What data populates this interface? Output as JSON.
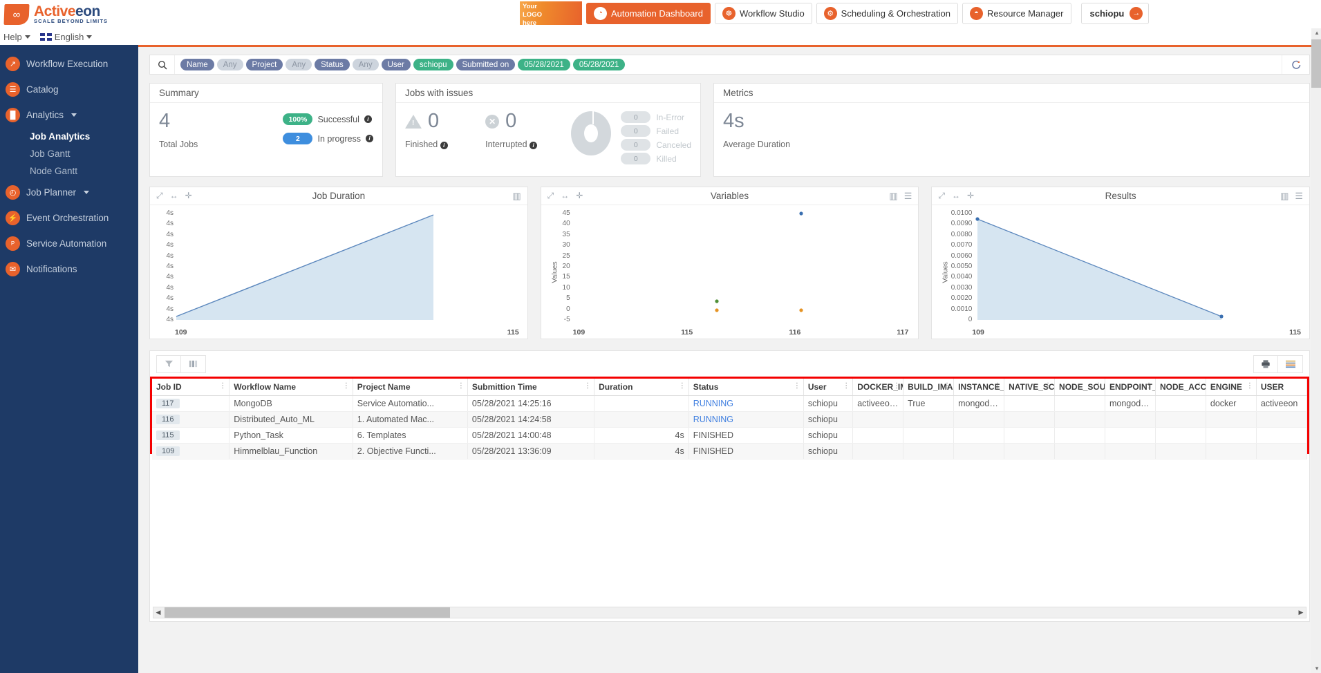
{
  "brand": {
    "name_a": "Active",
    "name_b": "eon",
    "tagline": "SCALE BEYOND LIMITS",
    "logo_glyph": "∞"
  },
  "topnav": {
    "your_logo": {
      "l1": "Your",
      "l2": "LOGO",
      "l3": "here"
    },
    "items": [
      {
        "label": "Automation Dashboard",
        "icon": "speedometer-icon",
        "glyph": "◔",
        "active": true
      },
      {
        "label": "Workflow Studio",
        "icon": "studio-icon",
        "glyph": "☸",
        "active": false
      },
      {
        "label": "Scheduling & Orchestration",
        "icon": "scheduling-icon",
        "glyph": "⚙",
        "active": false
      },
      {
        "label": "Resource Manager",
        "icon": "resource-icon",
        "glyph": "◓",
        "active": false
      }
    ],
    "user": {
      "label": "schiopu",
      "icon": "logout-icon",
      "glyph": "→"
    }
  },
  "helprow": {
    "help": "Help",
    "language": "English"
  },
  "sidebar": {
    "items": [
      {
        "label": "Workflow Execution",
        "icon": "workflow-execution-icon",
        "glyph": "↗",
        "caret": false
      },
      {
        "label": "Catalog",
        "icon": "catalog-icon",
        "glyph": "☰",
        "caret": false
      },
      {
        "label": "Analytics",
        "icon": "analytics-icon",
        "glyph": "█",
        "caret": true
      },
      {
        "label": "Job Planner",
        "icon": "job-planner-icon",
        "glyph": "◴",
        "caret": true
      },
      {
        "label": "Event Orchestration",
        "icon": "event-orchestration-icon",
        "glyph": "⚡",
        "caret": false
      },
      {
        "label": "Service Automation",
        "icon": "service-automation-icon",
        "glyph": "P",
        "caret": false
      },
      {
        "label": "Notifications",
        "icon": "notifications-icon",
        "glyph": "✉",
        "caret": false
      }
    ],
    "analytics_children": [
      {
        "label": "Job Analytics",
        "active": true
      },
      {
        "label": "Job Gantt",
        "active": false
      },
      {
        "label": "Node Gantt",
        "active": false
      }
    ]
  },
  "filterbar": {
    "search_icon": "search-icon",
    "refresh_icon": "refresh-icon",
    "chips": [
      {
        "text": "Name",
        "kind": "key"
      },
      {
        "text": "Any",
        "kind": "any"
      },
      {
        "text": "Project",
        "kind": "key"
      },
      {
        "text": "Any",
        "kind": "any"
      },
      {
        "text": "Status",
        "kind": "key"
      },
      {
        "text": "Any",
        "kind": "any"
      },
      {
        "text": "User",
        "kind": "key"
      },
      {
        "text": "schiopu",
        "kind": "val"
      },
      {
        "text": "Submitted on",
        "kind": "key"
      },
      {
        "text": "05/28/2021",
        "kind": "val"
      },
      {
        "text": "05/28/2021",
        "kind": "val"
      }
    ]
  },
  "summary": {
    "title": "Summary",
    "total_value": "4",
    "total_label": "Total Jobs",
    "rows": [
      {
        "pill": "100%",
        "label": "Successful",
        "color": "green"
      },
      {
        "pill": "2",
        "label": "In progress",
        "color": "blue"
      }
    ]
  },
  "issues": {
    "title": "Jobs with issues",
    "finished": {
      "value": "0",
      "label": "Finished"
    },
    "interrupted": {
      "value": "0",
      "label": "Interrupted"
    },
    "legend": [
      {
        "count": "0",
        "label": "In-Error"
      },
      {
        "count": "0",
        "label": "Failed"
      },
      {
        "count": "0",
        "label": "Canceled"
      },
      {
        "count": "0",
        "label": "Killed"
      }
    ]
  },
  "metrics": {
    "title": "Metrics",
    "value": "4s",
    "label": "Average Duration"
  },
  "chart_data": [
    {
      "type": "area",
      "title": "Job Duration",
      "xlabel": "",
      "ylabel": "",
      "x": [
        109,
        115
      ],
      "categories": [
        "109",
        "115"
      ],
      "values": [
        0.08,
        0.93
      ],
      "ytick_labels": [
        "4s",
        "4s",
        "4s",
        "4s",
        "4s",
        "4s",
        "4s",
        "4s",
        "4s",
        "4s",
        "4s"
      ],
      "xtick_labels": [
        "109",
        "115"
      ],
      "grid": false,
      "legend": "none",
      "tools": [
        "expand-icon",
        "resize-horizontal-icon",
        "move-icon"
      ],
      "right_tools": [
        "bar-chart-icon"
      ]
    },
    {
      "type": "scatter",
      "title": "Variables",
      "xlabel": "",
      "ylabel": "Values",
      "categories": [
        "109",
        "115",
        "116",
        "117"
      ],
      "ytick_labels": [
        "45",
        "40",
        "35",
        "30",
        "25",
        "20",
        "15",
        "10",
        "5",
        "0",
        "-5"
      ],
      "ylim": [
        -5,
        45
      ],
      "series": [
        {
          "name": "blue",
          "color": "#3a6fb0",
          "points": [
            {
              "x": "117",
              "y": 45
            }
          ]
        },
        {
          "name": "green",
          "color": "#4f8f37",
          "points": [
            {
              "x": "116",
              "y": 2
            }
          ]
        },
        {
          "name": "orange",
          "color": "#e59324",
          "points": [
            {
              "x": "116",
              "y": -1
            },
            {
              "x": "117",
              "y": -1
            }
          ]
        }
      ],
      "grid": false,
      "legend": "none",
      "tools": [
        "expand-icon",
        "resize-horizontal-icon",
        "move-icon"
      ],
      "right_tools": [
        "bar-chart-icon",
        "list-icon"
      ]
    },
    {
      "type": "area",
      "title": "Results",
      "xlabel": "",
      "ylabel": "Values",
      "categories": [
        "109",
        "115"
      ],
      "x": [
        109,
        115
      ],
      "values": [
        0.0093,
        0.0
      ],
      "ytick_labels": [
        "0.0100",
        "0.0090",
        "0.0080",
        "0.0070",
        "0.0060",
        "0.0050",
        "0.0040",
        "0.0030",
        "0.0020",
        "0.0010",
        "0"
      ],
      "ylim": [
        0,
        0.01
      ],
      "grid": false,
      "legend": "none",
      "tools": [
        "expand-icon",
        "resize-horizontal-icon",
        "move-icon"
      ],
      "right_tools": [
        "bar-chart-icon",
        "list-icon"
      ]
    }
  ],
  "table_toolbar": {
    "filter_icon": "filter-icon",
    "columns_icon": "column-chooser-icon",
    "print_icon": "print-icon",
    "menu_icon": "list-menu-icon"
  },
  "table": {
    "columns": [
      {
        "label": "Job ID",
        "menu": true
      },
      {
        "label": "Workflow Name",
        "menu": true
      },
      {
        "label": "Project Name",
        "menu": true
      },
      {
        "label": "Submittion Time",
        "menu": true
      },
      {
        "label": "Duration",
        "menu": true
      },
      {
        "label": "Status",
        "menu": true
      },
      {
        "label": "User",
        "menu": true
      },
      {
        "label": "DOCKER_IM..",
        "menu": true
      },
      {
        "label": "BUILD_IMA..",
        "menu": true
      },
      {
        "label": "INSTANCE_..",
        "menu": true
      },
      {
        "label": "NATIVE_SCH..",
        "menu": true
      },
      {
        "label": "NODE_SOU..",
        "menu": true
      },
      {
        "label": "ENDPOINT_..",
        "menu": true
      },
      {
        "label": "NODE_ACCE..",
        "menu": true
      },
      {
        "label": "ENGINE",
        "menu": true
      },
      {
        "label": "USER",
        "menu": false
      }
    ],
    "rows": [
      {
        "job_id": "117",
        "workflow_name": "MongoDB",
        "project_name": "Service Automatio...",
        "submission_time": "05/28/2021 14:25:16",
        "duration": "",
        "status": "RUNNING",
        "status_kind": "running",
        "user": "schiopu",
        "docker_image": "activeeon/m...",
        "build_image": "True",
        "instance": "mongodb-se...",
        "native_scheduler": "",
        "node_source": "",
        "endpoint": "mongodb-en...",
        "node_access": "",
        "engine": "docker",
        "user2": "activeeon"
      },
      {
        "job_id": "116",
        "workflow_name": "Distributed_Auto_ML",
        "project_name": "1. Automated Mac...",
        "submission_time": "05/28/2021 14:24:58",
        "duration": "",
        "status": "RUNNING",
        "status_kind": "running",
        "user": "schiopu",
        "docker_image": "",
        "build_image": "",
        "instance": "",
        "native_scheduler": "",
        "node_source": "",
        "endpoint": "",
        "node_access": "",
        "engine": "",
        "user2": ""
      },
      {
        "job_id": "115",
        "workflow_name": "Python_Task",
        "project_name": "6. Templates",
        "submission_time": "05/28/2021 14:00:48",
        "duration": "4s",
        "status": "FINISHED",
        "status_kind": "finished",
        "user": "schiopu",
        "docker_image": "",
        "build_image": "",
        "instance": "",
        "native_scheduler": "",
        "node_source": "",
        "endpoint": "",
        "node_access": "",
        "engine": "",
        "user2": ""
      },
      {
        "job_id": "109",
        "workflow_name": "Himmelblau_Function",
        "project_name": "2. Objective Functi...",
        "submission_time": "05/28/2021 13:36:09",
        "duration": "4s",
        "status": "FINISHED",
        "status_kind": "finished",
        "user": "schiopu",
        "docker_image": "",
        "build_image": "",
        "instance": "",
        "native_scheduler": "",
        "node_source": "",
        "endpoint": "",
        "node_access": "",
        "engine": "",
        "user2": ""
      }
    ]
  },
  "colors": {
    "accent": "#e8622c",
    "sidebar": "#1e3a66",
    "running": "#3f7fe0",
    "highlight": "#f40000",
    "green": "#3db287",
    "blue": "#3e8ede"
  }
}
